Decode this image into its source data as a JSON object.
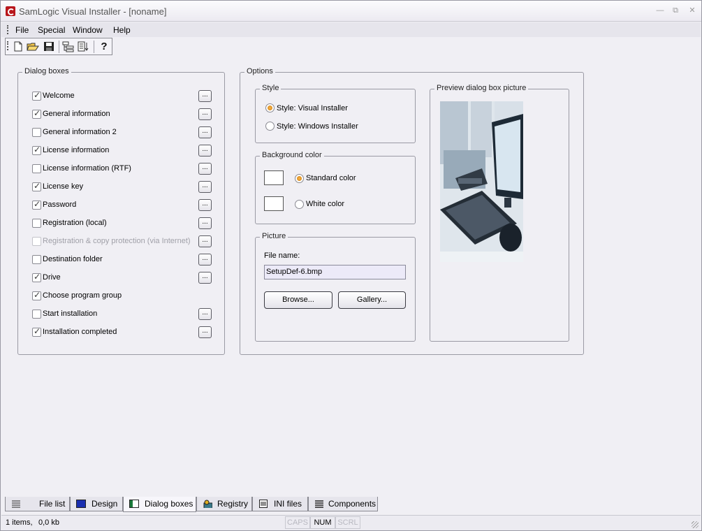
{
  "window": {
    "title": "SamLogic Visual Installer - [noname]",
    "minimize_icon": "minimize-icon",
    "restore_icon": "restore-icon",
    "close_icon": "close-icon"
  },
  "menu": [
    {
      "label": "File"
    },
    {
      "label": "Special"
    },
    {
      "label": "Window"
    },
    {
      "label": "Help"
    }
  ],
  "toolbar": {
    "buttons": [
      "new-icon",
      "open-icon",
      "save-icon",
      "tree-icon",
      "sort-icon",
      "help-icon"
    ]
  },
  "dialog_boxes": {
    "label": "Dialog boxes",
    "items": [
      {
        "label": "Welcome",
        "checked": true,
        "enabled": true,
        "has_button": true
      },
      {
        "label": "General information",
        "checked": true,
        "enabled": true,
        "has_button": true
      },
      {
        "label": "General information 2",
        "checked": false,
        "enabled": true,
        "has_button": true
      },
      {
        "label": "License information",
        "checked": true,
        "enabled": true,
        "has_button": true
      },
      {
        "label": "License information (RTF)",
        "checked": false,
        "enabled": true,
        "has_button": true
      },
      {
        "label": "License key",
        "checked": true,
        "enabled": true,
        "has_button": true
      },
      {
        "label": "Password",
        "checked": true,
        "enabled": true,
        "has_button": true
      },
      {
        "label": "Registration (local)",
        "checked": false,
        "enabled": true,
        "has_button": true
      },
      {
        "label": "Registration & copy protection (via Internet)",
        "checked": false,
        "enabled": false,
        "has_button": true
      },
      {
        "label": "Destination folder",
        "checked": false,
        "enabled": true,
        "has_button": true
      },
      {
        "label": "Drive",
        "checked": true,
        "enabled": true,
        "has_button": true
      },
      {
        "label": "Choose program group",
        "checked": true,
        "enabled": true,
        "has_button": false
      },
      {
        "label": "Start installation",
        "checked": false,
        "enabled": true,
        "has_button": true
      },
      {
        "label": "Installation completed",
        "checked": true,
        "enabled": true,
        "has_button": true
      }
    ],
    "button_label": "..."
  },
  "options": {
    "label": "Options",
    "style": {
      "label": "Style",
      "option1": "Style: Visual Installer",
      "option2": "Style: Windows Installer",
      "selected": 1
    },
    "background_color": {
      "label": "Background color",
      "standard": "Standard color",
      "white": "White color",
      "selected": "standard"
    },
    "picture": {
      "label": "Picture",
      "file_name_label": "File name:",
      "file_name_value": "SetupDef-6.bmp",
      "browse_label": "Browse...",
      "gallery_label": "Gallery..."
    },
    "preview": {
      "label": "Preview dialog box picture"
    }
  },
  "tabs": [
    {
      "label": "File list",
      "icon": "list-icon"
    },
    {
      "label": "Design",
      "icon": "design-icon"
    },
    {
      "label": "Dialog boxes",
      "icon": "dialog-icon",
      "active": true
    },
    {
      "label": "Registry",
      "icon": "registry-icon"
    },
    {
      "label": "INI files",
      "icon": "ini-file-icon"
    },
    {
      "label": "Components",
      "icon": "components-icon"
    }
  ],
  "status": {
    "items": "1 items,",
    "size": "0,0 kb",
    "caps": "CAPS",
    "num": "NUM",
    "scrl": "SCRL"
  },
  "colors": {
    "accent_radio": "#e28e18",
    "window_bg": "#f0eff4"
  }
}
